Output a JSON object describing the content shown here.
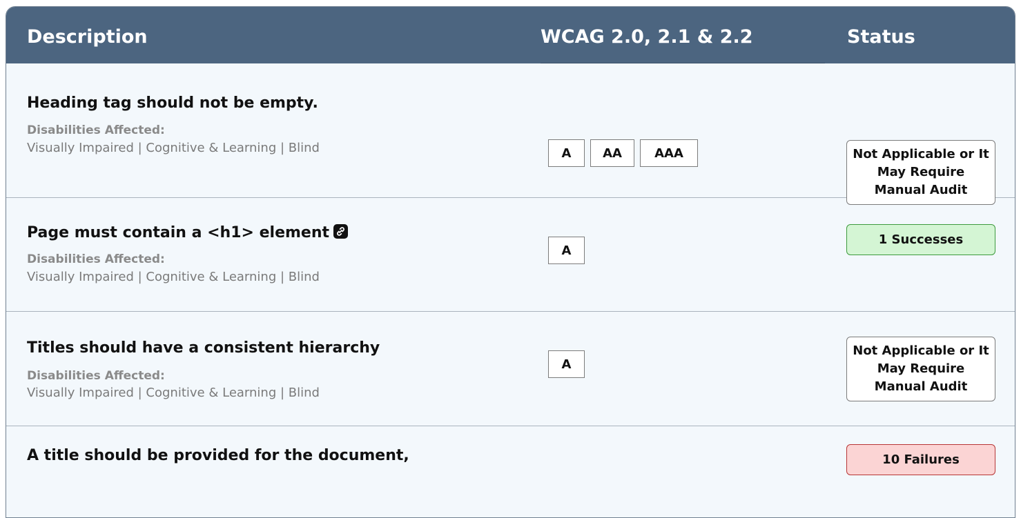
{
  "header": {
    "description": "Description",
    "wcag": "WCAG 2.0, 2.1 & 2.2",
    "status": "Status"
  },
  "rows": [
    {
      "title": "Heading tag should not be empty.",
      "disabilities_label": "Disabilities Affected:",
      "disabilities": "Visually Impaired | Cognitive & Learning | Blind",
      "levels": [
        "A",
        "AA",
        "AAA"
      ],
      "status": "Not Applicable or It May Require Manual Audit",
      "status_type": "not-applicable"
    },
    {
      "title": "Page must contain a <h1> element",
      "title_icon": "link-icon",
      "disabilities_label": "Disabilities Affected:",
      "disabilities": "Visually Impaired | Cognitive & Learning | Blind",
      "levels": [
        "A"
      ],
      "status": "1 Successes",
      "status_type": "success"
    },
    {
      "title": "Titles should have a consistent hierarchy",
      "disabilities_label": "Disabilities Affected:",
      "disabilities": "Visually Impaired | Cognitive & Learning | Blind",
      "levels": [
        "A"
      ],
      "status": "Not Applicable or It May Require Manual Audit",
      "status_type": "not-applicable"
    },
    {
      "title": "A title should be provided for the document,",
      "status": "10 Failures",
      "status_type": "failure"
    }
  ],
  "colors": {
    "header_bg": "#4c6580",
    "row_bg": "#f3f8fc",
    "success_bg": "#d4f5d4",
    "success_border": "#3c9a3c",
    "failure_bg": "#fbd4d4",
    "failure_border": "#b73535"
  }
}
